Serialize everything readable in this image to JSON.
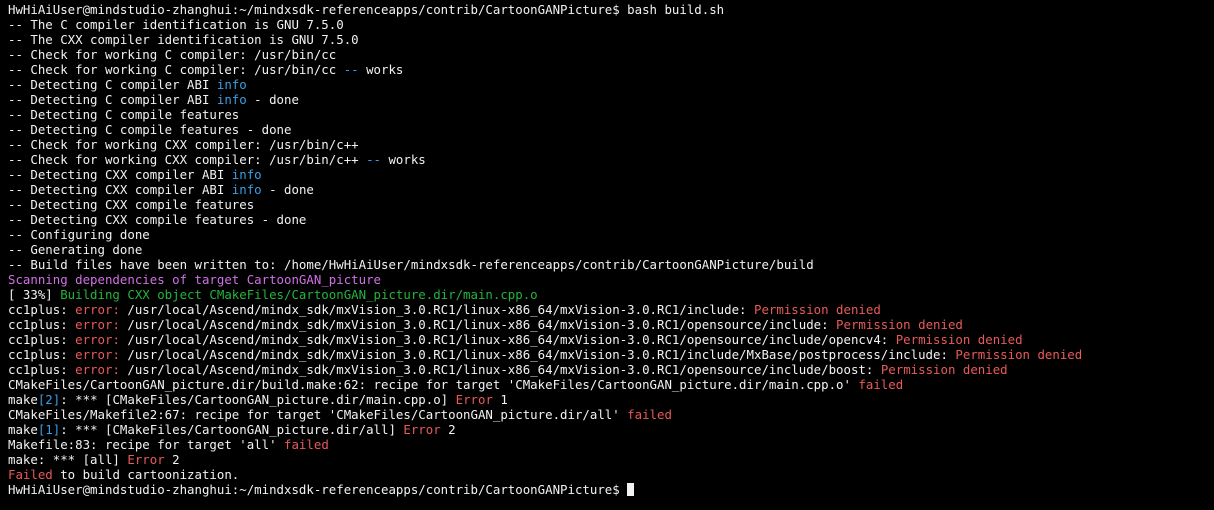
{
  "colors": {
    "background": "#000000",
    "default": "#f2f2f2",
    "info": "#3b9ee6",
    "error": "#e85a5a",
    "magenta": "#d070e6",
    "green": "#25b33e"
  },
  "terminal": {
    "lines": [
      [
        {
          "text": "HwHiAiUser@mindstudio-zhanghui:~/mindxsdk-referenceapps/contrib/CartoonGANPicture$ bash build.sh",
          "color": "default"
        }
      ],
      [
        {
          "text": "-- The C compiler identification is GNU 7.5.0",
          "color": "default"
        }
      ],
      [
        {
          "text": "-- The CXX compiler identification is GNU 7.5.0",
          "color": "default"
        }
      ],
      [
        {
          "text": "-- Check for working C compiler: /usr/bin/cc",
          "color": "default"
        }
      ],
      [
        {
          "text": "-- Check for working C compiler: /usr/bin/cc ",
          "color": "default"
        },
        {
          "text": "--",
          "color": "info"
        },
        {
          "text": " works",
          "color": "default"
        }
      ],
      [
        {
          "text": "-- Detecting C compiler ABI ",
          "color": "default"
        },
        {
          "text": "info",
          "color": "info"
        }
      ],
      [
        {
          "text": "-- Detecting C compiler ABI ",
          "color": "default"
        },
        {
          "text": "info",
          "color": "info"
        },
        {
          "text": " - done",
          "color": "default"
        }
      ],
      [
        {
          "text": "-- Detecting C compile features",
          "color": "default"
        }
      ],
      [
        {
          "text": "-- Detecting C compile features - done",
          "color": "default"
        }
      ],
      [
        {
          "text": "-- Check for working CXX compiler: /usr/bin/c++",
          "color": "default"
        }
      ],
      [
        {
          "text": "-- Check for working CXX compiler: /usr/bin/c++ ",
          "color": "default"
        },
        {
          "text": "--",
          "color": "info"
        },
        {
          "text": " works",
          "color": "default"
        }
      ],
      [
        {
          "text": "-- Detecting CXX compiler ABI ",
          "color": "default"
        },
        {
          "text": "info",
          "color": "info"
        }
      ],
      [
        {
          "text": "-- Detecting CXX compiler ABI ",
          "color": "default"
        },
        {
          "text": "info",
          "color": "info"
        },
        {
          "text": " - done",
          "color": "default"
        }
      ],
      [
        {
          "text": "-- Detecting CXX compile features",
          "color": "default"
        }
      ],
      [
        {
          "text": "-- Detecting CXX compile features - done",
          "color": "default"
        }
      ],
      [
        {
          "text": "-- Configuring done",
          "color": "default"
        }
      ],
      [
        {
          "text": "-- Generating done",
          "color": "default"
        }
      ],
      [
        {
          "text": "-- Build files have been written to: /home/HwHiAiUser/mindxsdk-referenceapps/contrib/CartoonGANPicture/build",
          "color": "default"
        }
      ],
      [
        {
          "text": "Scanning dependencies of target CartoonGAN_picture",
          "color": "magenta"
        }
      ],
      [
        {
          "text": "[ 33%] ",
          "color": "default"
        },
        {
          "text": "Building CXX object CMakeFiles/CartoonGAN_picture.dir/main.cpp.o",
          "color": "green"
        }
      ],
      [
        {
          "text": "cc1plus: ",
          "color": "default"
        },
        {
          "text": "error: ",
          "color": "error"
        },
        {
          "text": "/usr/local/Ascend/mindx_sdk/mxVision_3.0.RC1/linux-x86_64/mxVision-3.0.RC1/include: ",
          "color": "default"
        },
        {
          "text": "Permission denied",
          "color": "error"
        }
      ],
      [
        {
          "text": "cc1plus: ",
          "color": "default"
        },
        {
          "text": "error: ",
          "color": "error"
        },
        {
          "text": "/usr/local/Ascend/mindx_sdk/mxVision_3.0.RC1/linux-x86_64/mxVision-3.0.RC1/opensource/include: ",
          "color": "default"
        },
        {
          "text": "Permission denied",
          "color": "error"
        }
      ],
      [
        {
          "text": "cc1plus: ",
          "color": "default"
        },
        {
          "text": "error: ",
          "color": "error"
        },
        {
          "text": "/usr/local/Ascend/mindx_sdk/mxVision_3.0.RC1/linux-x86_64/mxVision-3.0.RC1/opensource/include/opencv4: ",
          "color": "default"
        },
        {
          "text": "Permission denied",
          "color": "error"
        }
      ],
      [
        {
          "text": "cc1plus: ",
          "color": "default"
        },
        {
          "text": "error: ",
          "color": "error"
        },
        {
          "text": "/usr/local/Ascend/mindx_sdk/mxVision_3.0.RC1/linux-x86_64/mxVision-3.0.RC1/include/MxBase/postprocess/include: ",
          "color": "default"
        },
        {
          "text": "Permission denied",
          "color": "error"
        }
      ],
      [
        {
          "text": "cc1plus: ",
          "color": "default"
        },
        {
          "text": "error: ",
          "color": "error"
        },
        {
          "text": "/usr/local/Ascend/mindx_sdk/mxVision_3.0.RC1/linux-x86_64/mxVision-3.0.RC1/opensource/include/boost: ",
          "color": "default"
        },
        {
          "text": "Permission denied",
          "color": "error"
        }
      ],
      [
        {
          "text": "CMakeFiles/CartoonGAN_picture.dir/build.make:62: recipe for target 'CMakeFiles/CartoonGAN_picture.dir/main.cpp.o' ",
          "color": "default"
        },
        {
          "text": "failed",
          "color": "error"
        }
      ],
      [
        {
          "text": "make",
          "color": "default"
        },
        {
          "text": "[2]",
          "color": "info"
        },
        {
          "text": ": *** [CMakeFiles/CartoonGAN_picture.dir/main.cpp.o] ",
          "color": "default"
        },
        {
          "text": "Error",
          "color": "error"
        },
        {
          "text": " 1",
          "color": "default"
        }
      ],
      [
        {
          "text": "CMakeFiles/Makefile2:67: recipe for target 'CMakeFiles/CartoonGAN_picture.dir/all' ",
          "color": "default"
        },
        {
          "text": "failed",
          "color": "error"
        }
      ],
      [
        {
          "text": "make",
          "color": "default"
        },
        {
          "text": "[1]",
          "color": "info"
        },
        {
          "text": ": *** [CMakeFiles/CartoonGAN_picture.dir/all] ",
          "color": "default"
        },
        {
          "text": "Error",
          "color": "error"
        },
        {
          "text": " 2",
          "color": "default"
        }
      ],
      [
        {
          "text": "Makefile:83: recipe for target 'all' ",
          "color": "default"
        },
        {
          "text": "failed",
          "color": "error"
        }
      ],
      [
        {
          "text": "make: *** [all] ",
          "color": "default"
        },
        {
          "text": "Error",
          "color": "error"
        },
        {
          "text": " 2",
          "color": "default"
        }
      ],
      [
        {
          "text": "Failed",
          "color": "error"
        },
        {
          "text": " to build cartoonization.",
          "color": "default"
        }
      ],
      [
        {
          "text": "HwHiAiUser@mindstudio-zhanghui:~/mindxsdk-referenceapps/contrib/CartoonGANPicture$ ",
          "color": "default"
        }
      ]
    ]
  }
}
